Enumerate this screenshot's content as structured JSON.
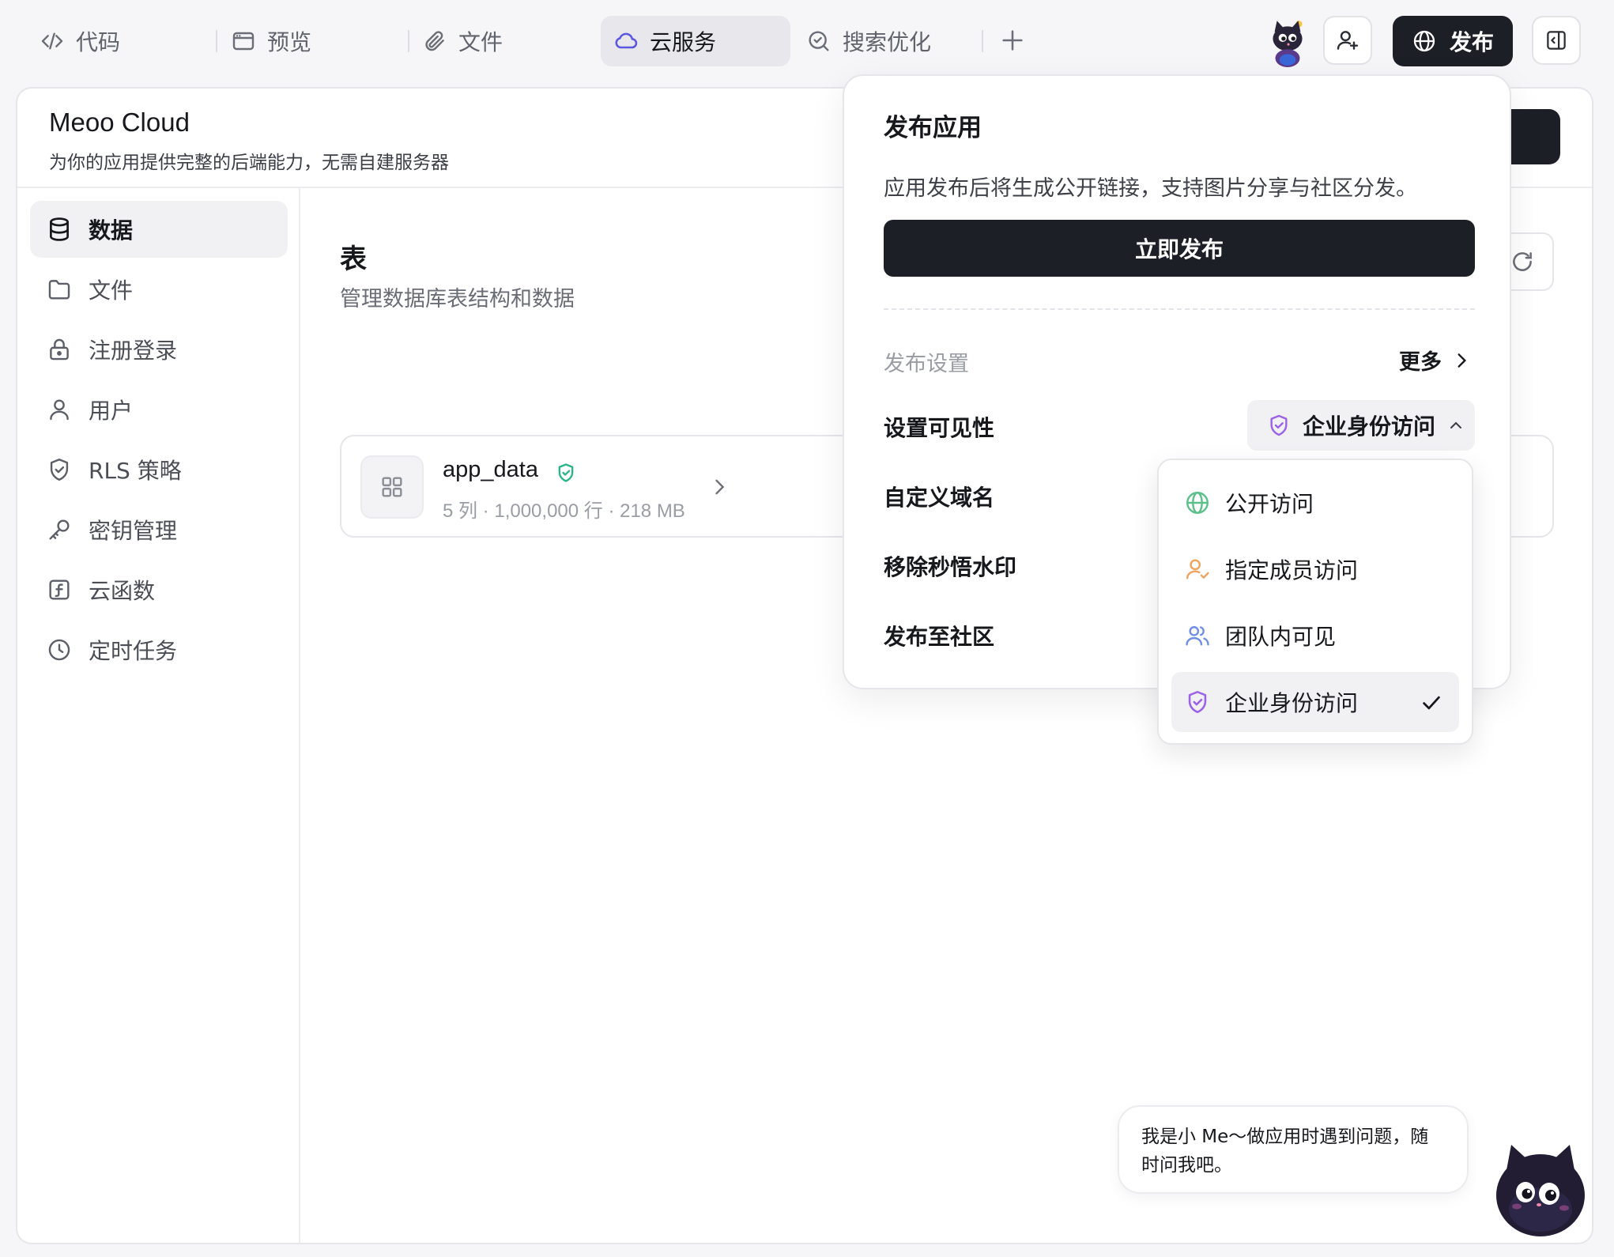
{
  "tabs": [
    {
      "label": "代码",
      "icon": "code-icon"
    },
    {
      "label": "预览",
      "icon": "browser-window-icon"
    },
    {
      "label": "文件",
      "icon": "paperclip-icon"
    },
    {
      "label": "云服务",
      "icon": "cloud-icon",
      "active": true
    },
    {
      "label": "搜索优化",
      "icon": "search-check-icon"
    }
  ],
  "topbar": {
    "publish_label": "发布",
    "add_tab_icon": "plus-icon",
    "invite_icon": "user-plus-icon",
    "panel_icon": "sidebar-toggle-icon"
  },
  "app": {
    "title": "Meoo Cloud",
    "subtitle": "为你的应用提供完整的后端能力，无需自建服务器"
  },
  "sidebar": {
    "items": [
      {
        "label": "数据",
        "icon": "database-icon",
        "active": true
      },
      {
        "label": "文件",
        "icon": "folder-icon"
      },
      {
        "label": "注册登录",
        "icon": "lock-icon"
      },
      {
        "label": "用户",
        "icon": "user-icon"
      },
      {
        "label": "RLS 策略",
        "icon": "shield-check-icon"
      },
      {
        "label": "密钥管理",
        "icon": "key-icon"
      },
      {
        "label": "云函数",
        "icon": "function-icon"
      },
      {
        "label": "定时任务",
        "icon": "clock-icon"
      }
    ]
  },
  "content": {
    "title": "表",
    "subtitle": "管理数据库表结构和数据",
    "table": {
      "name": "app_data",
      "meta": "5 列 · 1,000,000 行 · 218 MB"
    }
  },
  "publish_popover": {
    "title": "发布应用",
    "description": "应用发布后将生成公开链接，支持图片分享与社区分发。",
    "publish_now": "立即发布",
    "settings_label": "发布设置",
    "more_label": "更多",
    "rows": {
      "visibility": "设置可见性",
      "custom_domain": "自定义域名",
      "remove_watermark": "移除秒悟水印",
      "publish_community": "发布至社区"
    },
    "visibility_value": "企业身份访问"
  },
  "visibility_dropdown": {
    "options": [
      {
        "label": "公开访问",
        "icon": "globe-icon",
        "color": "#5cc08a"
      },
      {
        "label": "指定成员访问",
        "icon": "user-check-icon",
        "color": "#f0a35e"
      },
      {
        "label": "团队内可见",
        "icon": "users-icon",
        "color": "#6f8fe6"
      },
      {
        "label": "企业身份访问",
        "icon": "shield-check-icon",
        "color": "#9b62e6",
        "selected": true
      }
    ]
  },
  "assistant": {
    "message": "我是小 Me～做应用时遇到问题，随时问我吧。"
  },
  "colors": {
    "accent": "#5b57e0",
    "dark_button": "#1d1f26",
    "verified": "#2bb58a"
  }
}
